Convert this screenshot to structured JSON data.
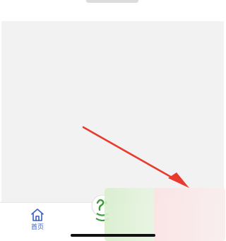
{
  "tabbar": {
    "home": {
      "label": "首页",
      "icon": "home-icon"
    },
    "center": {
      "icon": "app-logo-icon"
    }
  },
  "annotation": {
    "color": "#e83a2e",
    "icon": "red-arrow-icon"
  }
}
